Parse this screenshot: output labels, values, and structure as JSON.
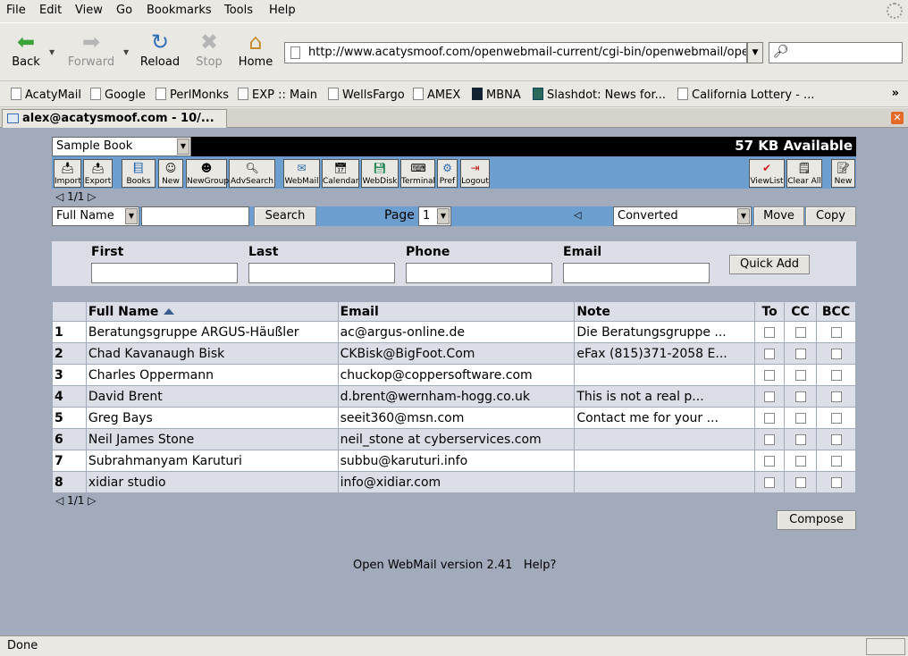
{
  "menu": [
    "File",
    "Edit",
    "View",
    "Go",
    "Bookmarks",
    "Tools",
    "Help"
  ],
  "nav": {
    "back": "Back",
    "forward": "Forward",
    "reload": "Reload",
    "stop": "Stop",
    "home": "Home",
    "url": "http://www.acatysmoof.com/openwebmail-current/cgi-bin/openwebmail/openwebmail-abook.pl"
  },
  "bookmarks": [
    "AcatyMail",
    "Google",
    "PerlMonks",
    "EXP :: Main",
    "WellsFargo",
    "AMEX",
    "MBNA",
    "Slashdot: News for...",
    "California Lottery - ..."
  ],
  "tab": {
    "title": "alex@acatysmoof.com - 10/..."
  },
  "abook": {
    "book_select": "Sample Book",
    "available": "57 KB Available",
    "icons_left": [
      "Import",
      "Export",
      "Books",
      "New",
      "NewGroup",
      "AdvSearch",
      "WebMail",
      "Calendar",
      "WebDisk",
      "Terminal",
      "Pref",
      "Logout"
    ],
    "icons_right": [
      "ViewList",
      "Clear All",
      "New"
    ],
    "pager": "1/1",
    "search_field": "Full Name",
    "search_button": "Search",
    "page_label": "Page",
    "page_value": "1",
    "target_folder": "Converted",
    "move_button": "Move",
    "copy_button": "Copy",
    "quickadd": {
      "first": "First",
      "last": "Last",
      "phone": "Phone",
      "email": "Email",
      "button": "Quick Add"
    },
    "columns": {
      "fullname": "Full Name",
      "email": "Email",
      "note": "Note",
      "to": "To",
      "cc": "CC",
      "bcc": "BCC"
    },
    "rows": [
      {
        "n": "1",
        "name": "Beratungsgruppe ARGUS-Häußler",
        "email": "ac@argus-online.de",
        "note": "Die Beratungsgruppe ..."
      },
      {
        "n": "2",
        "name": "Chad Kavanaugh Bisk",
        "email": "CKBisk@BigFoot.Com",
        "note": "eFax (815)371-2058 E..."
      },
      {
        "n": "3",
        "name": "Charles Oppermann",
        "email": "chuckop@coppersoftware.com",
        "note": ""
      },
      {
        "n": "4",
        "name": "David Brent",
        "email": "d.brent@wernham-hogg.co.uk",
        "note": "This is not a real p..."
      },
      {
        "n": "5",
        "name": "Greg Bays",
        "email": "seeit360@msn.com",
        "note": "Contact me for your ..."
      },
      {
        "n": "6",
        "name": "Neil James Stone",
        "email": "neil_stone at cyberservices.com",
        "note": ""
      },
      {
        "n": "7",
        "name": "Subrahmanyam Karuturi",
        "email": "subbu@karuturi.info",
        "note": ""
      },
      {
        "n": "8",
        "name": "xidiar studio",
        "email": "info@xidiar.com",
        "note": ""
      }
    ],
    "compose_button": "Compose",
    "version": "Open WebMail version 2.41",
    "help": "Help?"
  },
  "status": "Done",
  "colors": {
    "content_bg": "#a2abbc",
    "bar_blue": "#6d9ed0",
    "row_alt": "#dbdee6"
  }
}
